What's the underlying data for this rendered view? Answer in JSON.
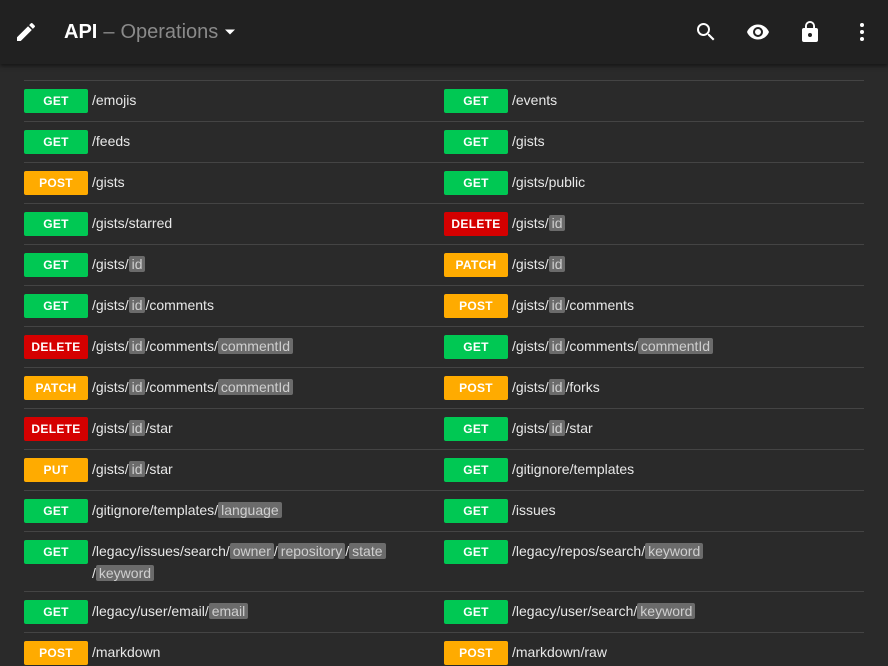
{
  "appbar": {
    "title": "API",
    "separator": "–",
    "subtitle": "Operations",
    "icons": [
      "edit-icon",
      "dropdown-caret-icon",
      "search-icon",
      "eye-icon",
      "lock-icon",
      "more-vert-icon"
    ]
  },
  "method_colors": {
    "GET": "#00c853",
    "POST": "#ffab00",
    "PATCH": "#ffab00",
    "PUT": "#ffab00",
    "DELETE": "#d50000"
  },
  "operations": [
    [
      {
        "method": "GET",
        "path": "/emojis"
      },
      {
        "method": "GET",
        "path": "/events"
      }
    ],
    [
      {
        "method": "GET",
        "path": "/feeds"
      },
      {
        "method": "GET",
        "path": "/gists"
      }
    ],
    [
      {
        "method": "POST",
        "path": "/gists"
      },
      {
        "method": "GET",
        "path": "/gists/public"
      }
    ],
    [
      {
        "method": "GET",
        "path": "/gists/starred"
      },
      {
        "method": "DELETE",
        "path": "/gists/{id}"
      }
    ],
    [
      {
        "method": "GET",
        "path": "/gists/{id}"
      },
      {
        "method": "PATCH",
        "path": "/gists/{id}"
      }
    ],
    [
      {
        "method": "GET",
        "path": "/gists/{id}/comments"
      },
      {
        "method": "POST",
        "path": "/gists/{id}/comments"
      }
    ],
    [
      {
        "method": "DELETE",
        "path": "/gists/{id}/comments/{commentId}"
      },
      {
        "method": "GET",
        "path": "/gists/{id}/comments/{commentId}"
      }
    ],
    [
      {
        "method": "PATCH",
        "path": "/gists/{id}/comments/{commentId}"
      },
      {
        "method": "POST",
        "path": "/gists/{id}/forks"
      }
    ],
    [
      {
        "method": "DELETE",
        "path": "/gists/{id}/star"
      },
      {
        "method": "GET",
        "path": "/gists/{id}/star"
      }
    ],
    [
      {
        "method": "PUT",
        "path": "/gists/{id}/star"
      },
      {
        "method": "GET",
        "path": "/gitignore/templates"
      }
    ],
    [
      {
        "method": "GET",
        "path": "/gitignore/templates/{language}"
      },
      {
        "method": "GET",
        "path": "/issues"
      }
    ],
    [
      {
        "method": "GET",
        "path": "/legacy/issues/search/{owner}/{repository}/{state}/{keyword}"
      },
      {
        "method": "GET",
        "path": "/legacy/repos/search/{keyword}"
      }
    ],
    [
      {
        "method": "GET",
        "path": "/legacy/user/email/{email}"
      },
      {
        "method": "GET",
        "path": "/legacy/user/search/{keyword}"
      }
    ],
    [
      {
        "method": "POST",
        "path": "/markdown"
      },
      {
        "method": "POST",
        "path": "/markdown/raw"
      }
    ]
  ]
}
